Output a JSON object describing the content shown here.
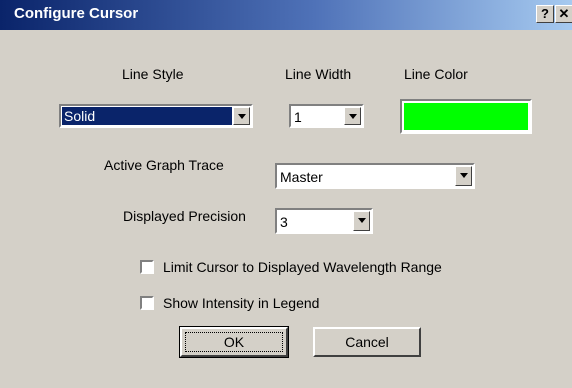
{
  "window": {
    "title": "Configure Cursor",
    "help_label": "?",
    "close_label": "✕"
  },
  "labels": {
    "line_style": "Line Style",
    "line_width": "Line Width",
    "line_color": "Line Color",
    "active_trace": "Active Graph Trace",
    "precision": "Displayed Precision"
  },
  "fields": {
    "line_style": "Solid",
    "line_width": "1",
    "line_color": "#00ff00",
    "active_trace": "Master",
    "precision": "3"
  },
  "checkboxes": {
    "limit_cursor": {
      "label": "Limit Cursor to Displayed Wavelength Range",
      "checked": false
    },
    "show_intensity": {
      "label": "Show Intensity in Legend",
      "checked": false
    }
  },
  "buttons": {
    "ok": "OK",
    "cancel": "Cancel"
  }
}
